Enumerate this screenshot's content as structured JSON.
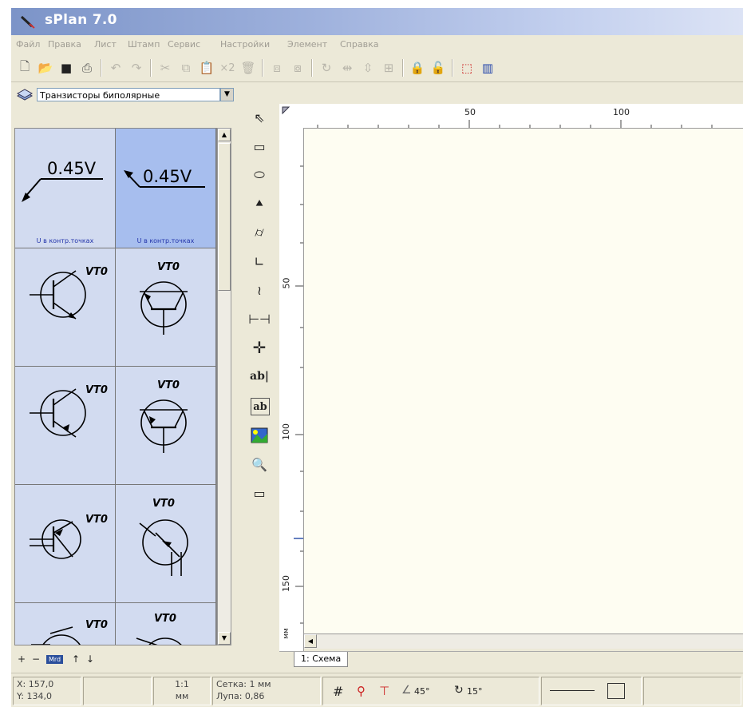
{
  "window": {
    "title": "sPlan 7.0"
  },
  "menu": {
    "items": [
      "Файл",
      "Правка",
      "Лист",
      "Штамп",
      "Сервис",
      "Настройки",
      "Элемент",
      "Справка"
    ]
  },
  "toolbar": {
    "buttons": [
      "new-icon",
      "open-icon",
      "save-icon",
      "print-icon",
      "undo-icon",
      "redo-icon",
      "cut-icon",
      "copy-icon",
      "paste-icon",
      "duplicate-icon",
      "delete-icon",
      "to-front-icon",
      "to-back-icon",
      "rotate-icon",
      "mirror-h-icon",
      "mirror-v-icon",
      "group-icon",
      "lock-icon",
      "unlock-icon",
      "snap-icon",
      "library-icon"
    ],
    "duplicate_label": "×2"
  },
  "library": {
    "selected": "Транзисторы биполярные",
    "components": [
      {
        "label": "0.45V",
        "caption": "U в контр.точках"
      },
      {
        "label": "0.45V",
        "caption": "U в контр.точках"
      },
      {
        "label": "VT0"
      },
      {
        "label": "VT0"
      },
      {
        "label": "VT0"
      },
      {
        "label": "VT0"
      },
      {
        "label": "VT0"
      },
      {
        "label": "VT0"
      },
      {
        "label": "VT0"
      },
      {
        "label": "VT0"
      }
    ],
    "nav": {
      "plus": "+",
      "minus": "−",
      "up": "↑",
      "down": "↓",
      "badge": "Mrd"
    }
  },
  "tools": [
    "select-icon",
    "rectangle-icon",
    "ellipse-icon",
    "polygon-icon",
    "polyline-icon",
    "line-icon",
    "bezier-icon",
    "dimension-icon",
    "junction-icon",
    "text-icon",
    "textbox-icon",
    "image-icon",
    "zoom-icon",
    "measure-icon"
  ],
  "tool_labels": {
    "text": "ab|",
    "textbox": "ab"
  },
  "rulers": {
    "top": [
      "50",
      "100"
    ],
    "left": [
      "50",
      "100",
      "150"
    ],
    "unit": "мм"
  },
  "sheet_tabs": [
    "1: Схема"
  ],
  "status": {
    "x": "X: 157,0",
    "y": "Y: 134,0",
    "scale": "1:1",
    "scale_unit": "мм",
    "grid": "Сетка: 1 мм",
    "zoom": "Лупа:  0,86",
    "angle1": "45°",
    "angle2": "15°"
  },
  "colors": {
    "accent": "#7C94C8",
    "palette_bg": "#D2DBF0",
    "palette_sel": "#A7BEEE",
    "canvas": "#FEFDF2"
  }
}
